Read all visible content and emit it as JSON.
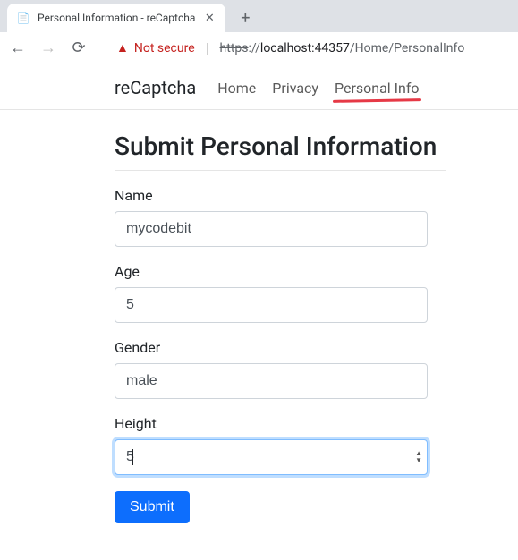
{
  "browser": {
    "tab_title": "Personal Information - reCaptcha",
    "security_label": "Not secure",
    "url_protocol": "https",
    "url_sep": "://",
    "url_host": "localhost:",
    "url_port": "44357",
    "url_path": "/Home/PersonalInfo"
  },
  "nav": {
    "brand": "reCaptcha",
    "links": [
      {
        "label": "Home"
      },
      {
        "label": "Privacy"
      },
      {
        "label": "Personal Info"
      }
    ]
  },
  "page": {
    "title": "Submit Personal Information"
  },
  "form": {
    "name": {
      "label": "Name",
      "value": "mycodebit"
    },
    "age": {
      "label": "Age",
      "value": "5"
    },
    "gender": {
      "label": "Gender",
      "value": "male"
    },
    "height": {
      "label": "Height",
      "value": "5"
    },
    "submit_label": "Submit"
  }
}
